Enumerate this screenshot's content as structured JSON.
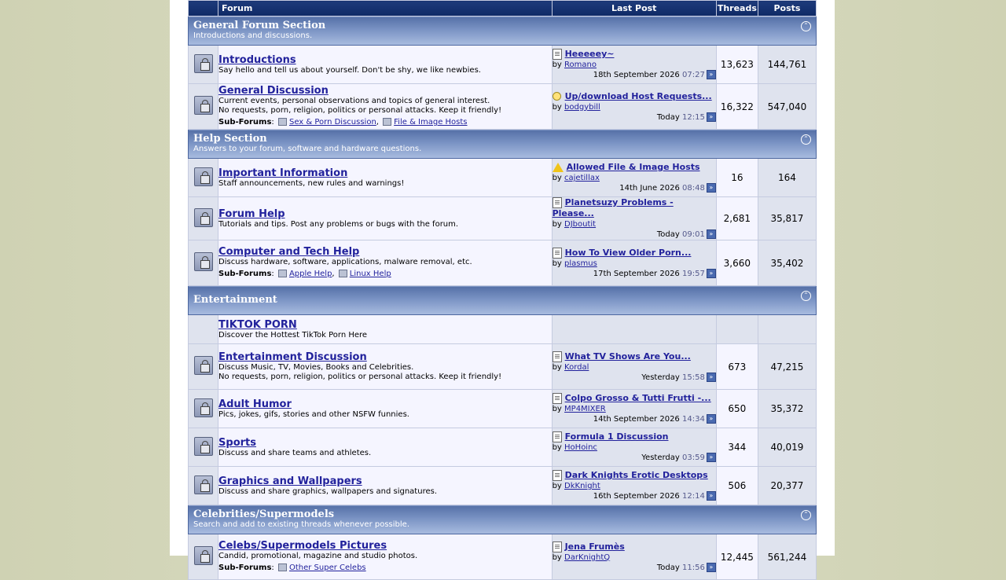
{
  "columns": {
    "forum": "Forum",
    "last_post": "Last Post",
    "threads": "Threads",
    "posts": "Posts"
  },
  "sections": [
    {
      "title": "General Forum Section",
      "desc": "Introductions and discussions.",
      "forums": [
        {
          "title": "Introductions",
          "desc": [
            "Say hello and tell us about yourself. Don't be shy, we like newbies."
          ],
          "last": {
            "icon": "thread-icon",
            "title": "Heeeeey~",
            "by": "by",
            "user": "Romano",
            "date": "18th September 2026",
            "time": "07:27"
          },
          "threads": "13,623",
          "posts": "144,761"
        },
        {
          "title": "General Discussion",
          "desc": [
            "Current events, personal observations and topics of general interest.",
            "No requests, porn, religion, politics or personal attacks. Keep it friendly!"
          ],
          "subforums_label": "Sub-Forums",
          "subforums": [
            "Sex & Porn Discussion",
            "File & Image Hosts"
          ],
          "last": {
            "icon": "lightbulb-icon",
            "title": "Up/download Host Requests...",
            "by": "by",
            "user": "bodgybill",
            "date": "Today",
            "time": "12:15"
          },
          "threads": "16,322",
          "posts": "547,040"
        }
      ]
    },
    {
      "title": "Help Section",
      "desc": "Answers to your forum, software and hardware questions.",
      "forums": [
        {
          "title": "Important Information",
          "desc": [
            "Staff announcements, new rules and warnings!"
          ],
          "last": {
            "icon": "warning-icon",
            "title": "Allowed File & Image Hosts",
            "by": "by",
            "user": "cajetillax",
            "date": "14th June 2026",
            "time": "08:48"
          },
          "threads": "16",
          "posts": "164"
        },
        {
          "title": "Forum Help",
          "desc": [
            "Tutorials and tips. Post any problems or bugs with the forum."
          ],
          "last": {
            "icon": "thread-icon",
            "title": "Planetsuzy Problems - Please...",
            "by": "by",
            "user": "DJboutit",
            "date": "Today",
            "time": "09:01"
          },
          "threads": "2,681",
          "posts": "35,817"
        },
        {
          "title": "Computer and Tech Help",
          "desc": [
            "Discuss hardware, software, applications, malware removal, etc."
          ],
          "subforums_label": "Sub-Forums",
          "subforums": [
            "Apple Help",
            "Linux Help"
          ],
          "last": {
            "icon": "thread-icon",
            "title": "How To View Older Porn...",
            "by": "by",
            "user": "plasmus",
            "date": "17th September 2026",
            "time": "19:57"
          },
          "threads": "3,660",
          "posts": "35,402"
        }
      ]
    },
    {
      "title": "Entertainment",
      "desc": "",
      "forums": [
        {
          "title": "TIKTOK PORN",
          "desc": [
            "Discover the Hottest TikTok Porn Here"
          ],
          "noicon": true,
          "last": null,
          "threads": "",
          "posts": ""
        },
        {
          "title": "Entertainment Discussion",
          "desc": [
            "Discuss Music, TV, Movies, Books and Celebrities.",
            "No requests, porn, religion, politics or personal attacks. Keep it friendly!"
          ],
          "last": {
            "icon": "thread-icon",
            "title": "What TV Shows Are You...",
            "by": "by",
            "user": "Kordal",
            "date": "Yesterday",
            "time": "15:58"
          },
          "threads": "673",
          "posts": "47,215"
        },
        {
          "title": "Adult Humor",
          "desc": [
            "Pics, jokes, gifs, stories and other NSFW funnies."
          ],
          "last": {
            "icon": "thread-icon",
            "title": "Colpo Grosso & Tutti Frutti -...",
            "by": "by",
            "user": "MP4MIXER",
            "date": "14th September 2026",
            "time": "14:34"
          },
          "threads": "650",
          "posts": "35,372"
        },
        {
          "title": "Sports",
          "desc": [
            "Discuss and share teams and athletes."
          ],
          "last": {
            "icon": "thread-icon",
            "title": "Formula 1 Discussion",
            "by": "by",
            "user": "HoHoinc",
            "date": "Yesterday",
            "time": "03:59"
          },
          "threads": "344",
          "posts": "40,019"
        },
        {
          "title": "Graphics and Wallpapers",
          "desc": [
            "Discuss and share graphics, wallpapers and signatures."
          ],
          "last": {
            "icon": "thread-icon",
            "title": "Dark Knights Erotic Desktops",
            "by": "by",
            "user": "DkKnight",
            "date": "16th September 2026",
            "time": "12:14"
          },
          "threads": "506",
          "posts": "20,377"
        }
      ]
    },
    {
      "title": "Celebrities/Supermodels",
      "desc": "Search and add to existing threads whenever possible.",
      "forums": [
        {
          "title": "Celebs/Supermodels Pictures",
          "desc": [
            "Candid, promotional, magazine and studio photos."
          ],
          "subforums_label": "Sub-Forums",
          "subforums": [
            "Other Super Celebs"
          ],
          "last": {
            "icon": "thread-icon",
            "title": "Jena Frumès",
            "by": "by",
            "user": "DarKnightQ",
            "date": "Today",
            "time": "11:56"
          },
          "threads": "12,445",
          "posts": "561,244"
        }
      ]
    }
  ]
}
